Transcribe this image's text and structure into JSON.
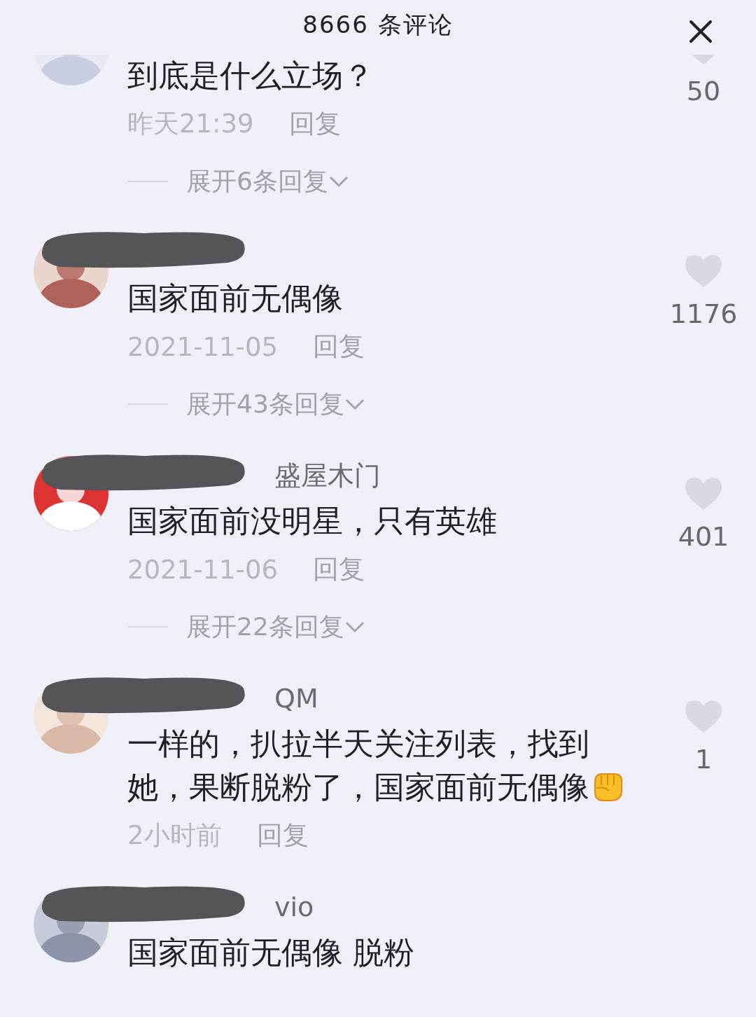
{
  "header": {
    "title": "8666 条评论"
  },
  "comments": [
    {
      "redacted": false,
      "lines": [
        "到底是什么立场？"
      ],
      "emoji": false,
      "time": "昨天21:39",
      "reply": "回复",
      "likes": "50",
      "expand": "展开6条回复"
    },
    {
      "redacted": true,
      "lines": [
        "国家面前无偶像"
      ],
      "emoji": false,
      "time": "2021-11-05",
      "reply": "回复",
      "likes": "1176",
      "expand": "展开43条回复"
    },
    {
      "name": "盛屋木门",
      "redacted": true,
      "lines": [
        "国家面前没明星，只有英雄"
      ],
      "emoji": false,
      "time": "2021-11-06",
      "reply": "回复",
      "likes": "401",
      "expand": "展开22条回复"
    },
    {
      "name": "QM",
      "redacted": true,
      "lines": [
        "一样的，扒拉半天关注列表，找到",
        "她，果断脱粉了，国家面前无偶像"
      ],
      "emoji": true,
      "time": "2小时前",
      "reply": "回复",
      "likes": "1"
    },
    {
      "name": "vio",
      "redacted": true,
      "lines": [
        "国家面前无偶像  脱粉"
      ],
      "emoji": false
    }
  ]
}
